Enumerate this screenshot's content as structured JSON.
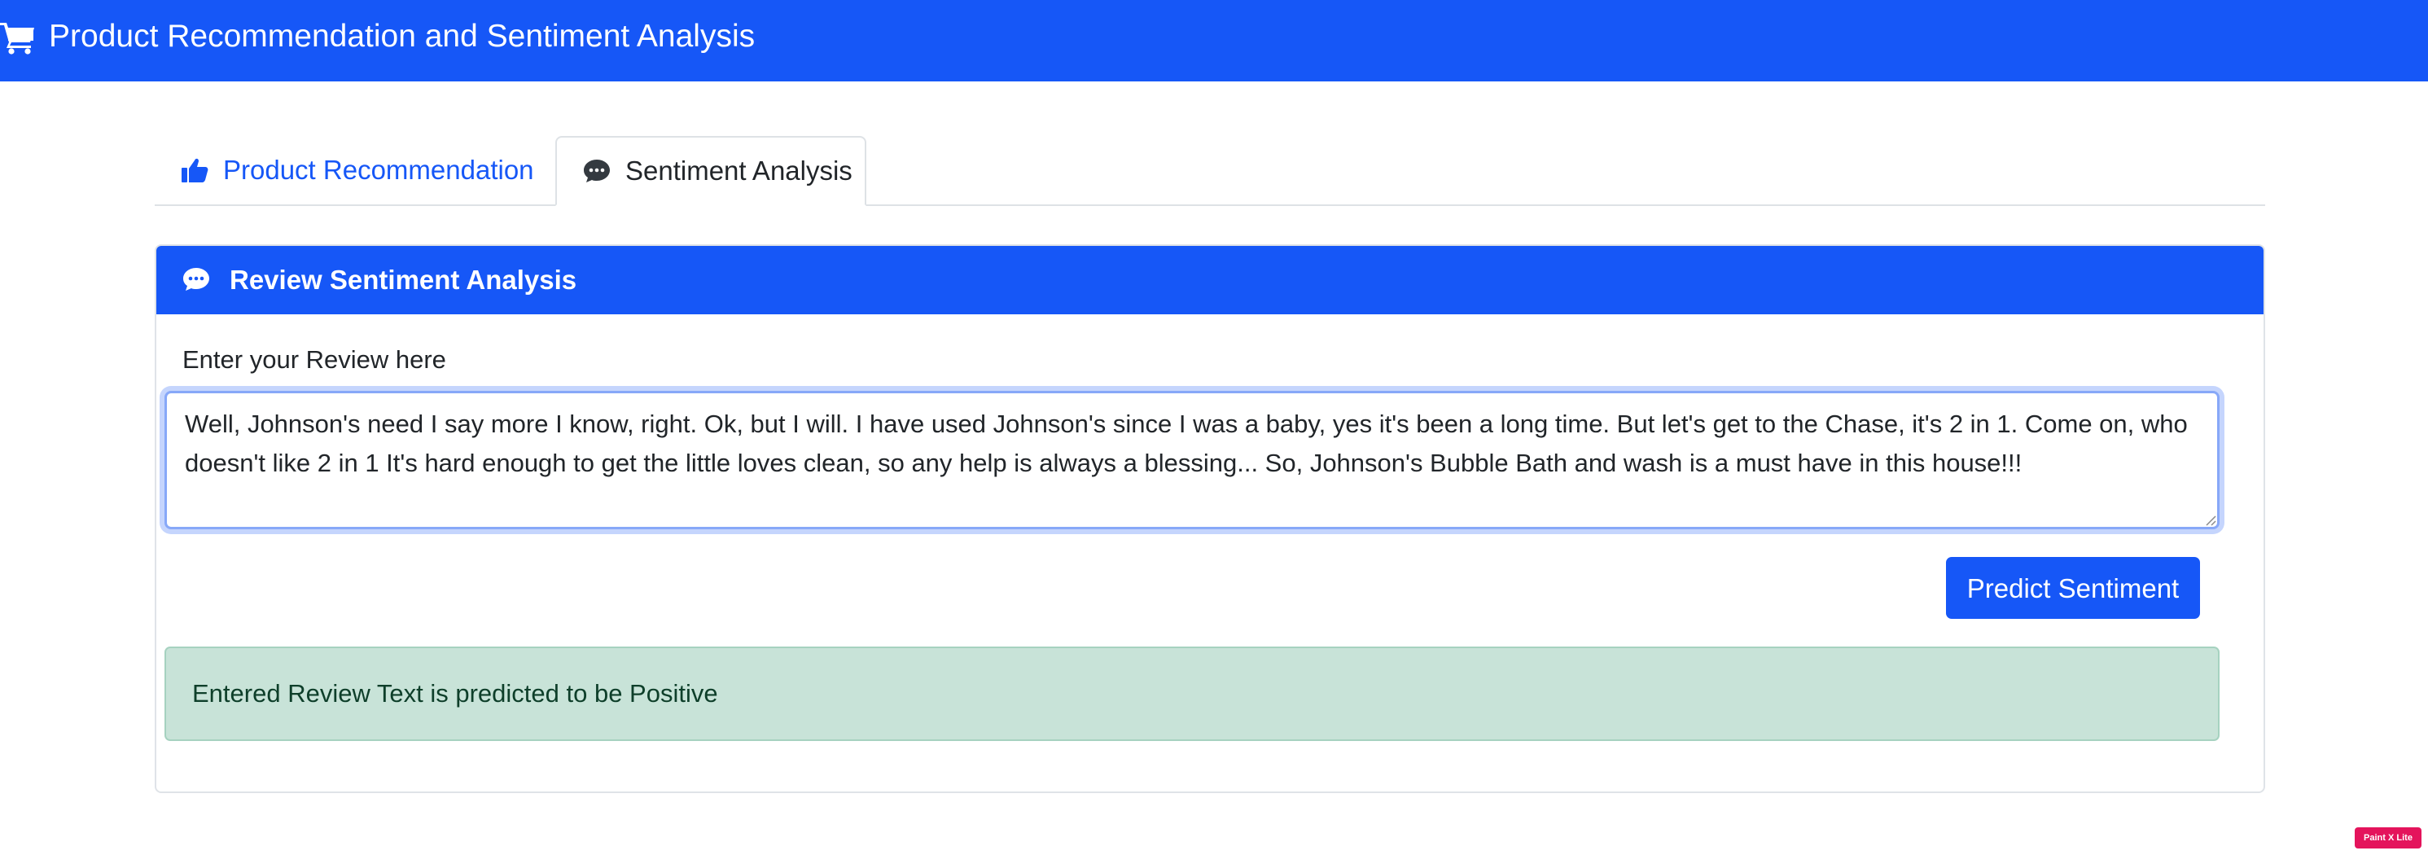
{
  "navbar": {
    "title": "Product Recommendation and Sentiment Analysis",
    "icon": "shopping-cart-icon",
    "color": "#1657f7"
  },
  "tabs": [
    {
      "label": "Product Recommendation",
      "icon": "thumbs-up-icon",
      "active": false
    },
    {
      "label": "Sentiment Analysis",
      "icon": "comment-dots-icon",
      "active": true
    }
  ],
  "card": {
    "header_title": "Review Sentiment Analysis",
    "header_icon": "comment-dots-icon",
    "review_label": "Enter your Review here",
    "review_text": "Well, Johnson's need I say more I know, right. Ok, but I will. I have used Johnson's since I was a baby, yes it's been a long time. But let's get to the Chase, it's 2 in 1. Come on, who doesn't like 2 in 1 It's hard enough to get the little loves clean, so any help is always a blessing... So, Johnson's Bubble Bath and wash is a must have in this house!!!",
    "predict_button_label": "Predict Sentiment",
    "result_text": "Entered Review Text is predicted to be Positive",
    "result_color": "#c8e3d8"
  },
  "watermark": {
    "text": "Paint X Lite"
  }
}
